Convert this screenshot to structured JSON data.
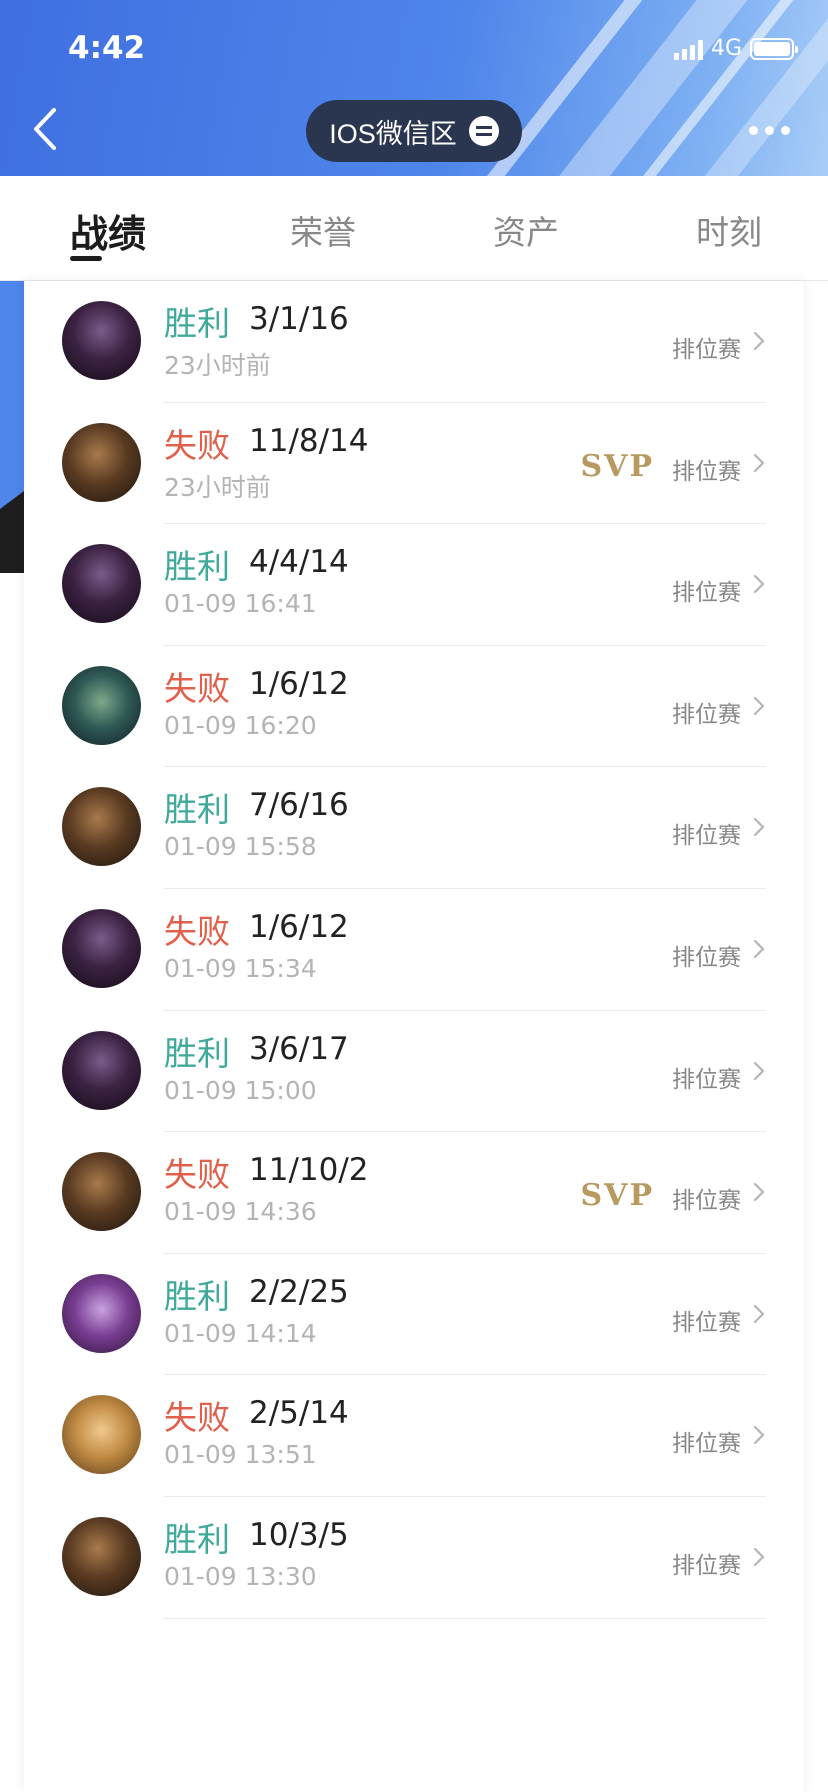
{
  "status": {
    "time": "4:42",
    "network": "4G"
  },
  "header": {
    "region_label": "IOS微信区"
  },
  "tabs": [
    {
      "label": "战绩"
    },
    {
      "label": "荣誉"
    },
    {
      "label": "资产"
    },
    {
      "label": "时刻"
    }
  ],
  "matches": [
    {
      "result": "胜利",
      "outcome": "win",
      "kda": "3/1/16",
      "time": "23小时前",
      "mode": "排位赛",
      "svp": "",
      "avatar": "purple-hero"
    },
    {
      "result": "失败",
      "outcome": "lose",
      "kda": "11/8/14",
      "time": "23小时前",
      "mode": "排位赛",
      "svp": "SVP",
      "avatar": "bronze-hero"
    },
    {
      "result": "胜利",
      "outcome": "win",
      "kda": "4/4/14",
      "time": "01-09 16:41",
      "mode": "排位赛",
      "svp": "",
      "avatar": "purple-hero"
    },
    {
      "result": "失败",
      "outcome": "lose",
      "kda": "1/6/12",
      "time": "01-09 16:20",
      "mode": "排位赛",
      "svp": "",
      "avatar": "teal-hero"
    },
    {
      "result": "胜利",
      "outcome": "win",
      "kda": "7/6/16",
      "time": "01-09 15:58",
      "mode": "排位赛",
      "svp": "",
      "avatar": "bronze-hero"
    },
    {
      "result": "失败",
      "outcome": "lose",
      "kda": "1/6/12",
      "time": "01-09 15:34",
      "mode": "排位赛",
      "svp": "",
      "avatar": "purple-hero"
    },
    {
      "result": "胜利",
      "outcome": "win",
      "kda": "3/6/17",
      "time": "01-09 15:00",
      "mode": "排位赛",
      "svp": "",
      "avatar": "purple-hero"
    },
    {
      "result": "失败",
      "outcome": "lose",
      "kda": "11/10/2",
      "time": "01-09 14:36",
      "mode": "排位赛",
      "svp": "SVP",
      "avatar": "bronze-hero"
    },
    {
      "result": "胜利",
      "outcome": "win",
      "kda": "2/2/25",
      "time": "01-09 14:14",
      "mode": "排位赛",
      "svp": "",
      "avatar": "violet-hero"
    },
    {
      "result": "失败",
      "outcome": "lose",
      "kda": "2/5/14",
      "time": "01-09 13:51",
      "mode": "排位赛",
      "svp": "",
      "avatar": "gold-hero"
    },
    {
      "result": "胜利",
      "outcome": "win",
      "kda": "10/3/5",
      "time": "01-09 13:30",
      "mode": "排位赛",
      "svp": "",
      "avatar": "bronze-hero"
    }
  ],
  "colors": {
    "win": "#3fa99a",
    "lose": "#e0604b",
    "svp": "#b89a60",
    "header": "#4f86ea"
  }
}
